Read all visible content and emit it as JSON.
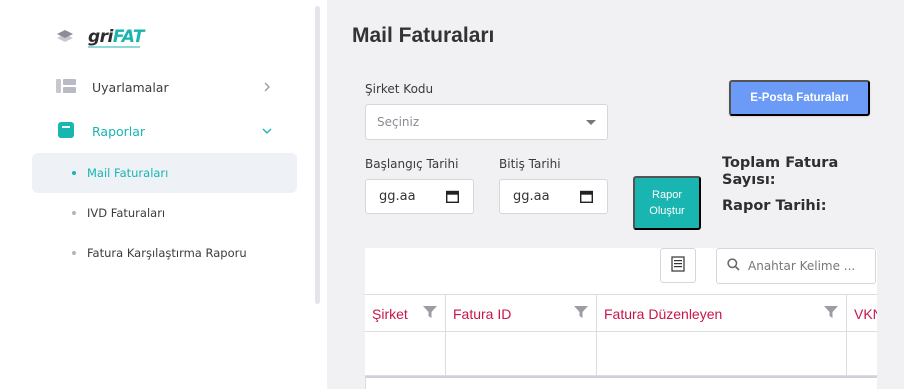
{
  "brand": {
    "logo_part1": "gri",
    "logo_part2": "FAT",
    "accent": "#19b5b0"
  },
  "sidebar": {
    "items": [
      {
        "label": "Uyarlamalar",
        "icon": "list-icon"
      },
      {
        "label": "Raporlar",
        "icon": "report-icon"
      }
    ],
    "subitems": [
      {
        "label": "Mail Faturaları",
        "active": true
      },
      {
        "label": "IVD Faturaları",
        "active": false
      },
      {
        "label": "Fatura Karşılaştırma Raporu",
        "active": false
      }
    ]
  },
  "page": {
    "title": "Mail Faturaları"
  },
  "form": {
    "company_label": "Şirket Kodu",
    "company_placeholder": "Seçiniz",
    "start_label": "Başlangıç Tarihi",
    "start_value": "gg.aa",
    "end_label": "Bitiş Tarihi",
    "end_value": "gg.aa",
    "email_button": "E-Posta Faturaları",
    "report_button_line1": "Rapor",
    "report_button_line2": "Oluştur"
  },
  "summary": {
    "total_line1": "Toplam Fatura",
    "total_line2": "Sayısı:",
    "report_date": "Rapor Tarihi:"
  },
  "grid": {
    "search_placeholder": "Anahtar Kelime ...",
    "columns": [
      "Şirket",
      "Fatura ID",
      "Fatura Düzenleyen",
      "VKN"
    ],
    "header_color": "#c8154a"
  }
}
